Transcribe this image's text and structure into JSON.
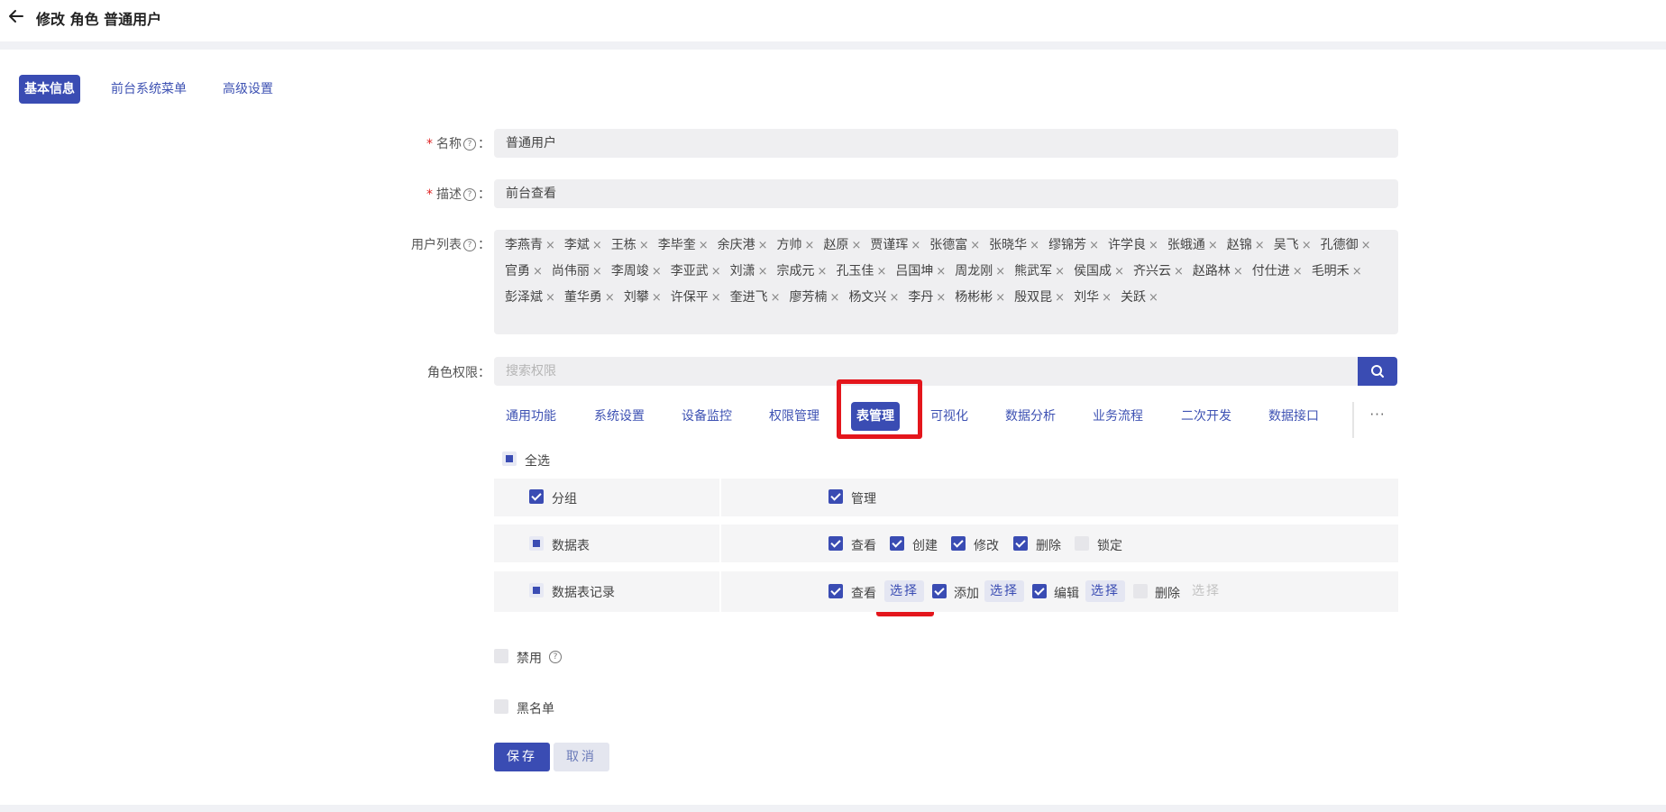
{
  "header": {
    "title": "修改 角色 普通用户"
  },
  "tabs": [
    "基本信息",
    "前台系统菜单",
    "高级设置"
  ],
  "form": {
    "name_label": "名称",
    "name_value": "普通用户",
    "desc_label": "描述",
    "desc_value": "前台查看",
    "users_label": "用户列表",
    "users": [
      "李燕青",
      "李斌",
      "王栋",
      "李毕奎",
      "余庆港",
      "方帅",
      "赵原",
      "贾谨珲",
      "张德富",
      "张晓华",
      "缪锦芳",
      "许学良",
      "张蛾通",
      "赵锦",
      "吴飞",
      "孔德御",
      "官勇",
      "尚伟丽",
      "李周竣",
      "李亚武",
      "刘潇",
      "宗成元",
      "孔玉佳",
      "吕国坤",
      "周龙刚",
      "熊武军",
      "侯国成",
      "齐兴云",
      "赵路林",
      "付仕进",
      "毛明禾",
      "彭泽斌",
      "董华勇",
      "刘攀",
      "许保平",
      "奎进飞",
      "廖芳楠",
      "杨文兴",
      "李丹",
      "杨彬彬",
      "殷双昆",
      "刘华",
      "关跃"
    ],
    "perm_label": "角色权限",
    "search_placeholder": "搜索权限",
    "colon": "："
  },
  "perm_tabs": [
    "通用功能",
    "系统设置",
    "设备监控",
    "权限管理",
    "表管理",
    "可视化",
    "数据分析",
    "业务流程",
    "二次开发",
    "数据接口"
  ],
  "active_perm_tab": "表管理",
  "more_label": "···",
  "select_all": "全选",
  "perm_rows": [
    {
      "name": "分组",
      "state": "checked",
      "actions": [
        {
          "label": "管理",
          "state": "checked"
        }
      ]
    },
    {
      "name": "数据表",
      "state": "partial",
      "actions": [
        {
          "label": "查看",
          "state": "checked"
        },
        {
          "label": "创建",
          "state": "checked"
        },
        {
          "label": "修改",
          "state": "checked"
        },
        {
          "label": "删除",
          "state": "checked"
        },
        {
          "label": "锁定",
          "state": "unchecked"
        }
      ]
    },
    {
      "name": "数据表记录",
      "state": "partial",
      "actions": [
        {
          "label": "查看",
          "state": "checked",
          "select": "选择"
        },
        {
          "label": "添加",
          "state": "checked",
          "select": "选择"
        },
        {
          "label": "编辑",
          "state": "checked",
          "select": "选择"
        },
        {
          "label": "删除",
          "state": "unchecked",
          "select": "选择",
          "select_disabled": true
        }
      ]
    }
  ],
  "disable_label": "禁用",
  "blacklist_label": "黑名单",
  "buttons": {
    "save": "保存",
    "cancel": "取消"
  },
  "colors": {
    "accent": "#3a4cb3",
    "highlight": "#e4161c"
  }
}
